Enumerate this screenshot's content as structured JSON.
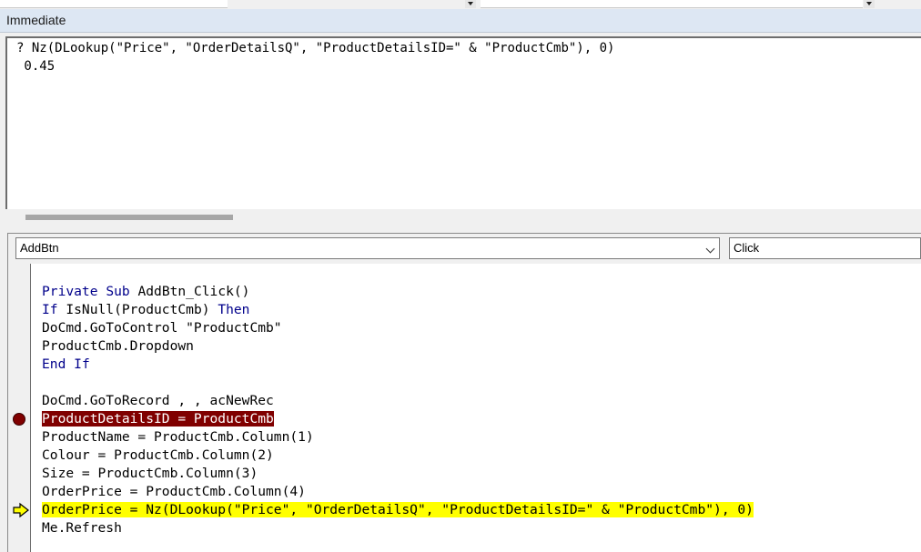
{
  "immediate": {
    "title": "Immediate",
    "lines": [
      "? Nz(DLookup(\"Price\", \"OrderDetailsQ\", \"ProductDetailsID=\" & \"ProductCmb\"), 0)",
      " 0.45"
    ]
  },
  "code_window": {
    "object_combo": "AddBtn",
    "procedure_combo": "Click",
    "code": {
      "sub_kw1": "Private",
      "sub_kw2": "Sub",
      "sub_rest": " AddBtn_Click()",
      "if_kw": "If",
      "if_mid": " IsNull(ProductCmb) ",
      "then_kw": "Then",
      "goto_control": "DoCmd.GoToControl \"ProductCmb\"",
      "dropdown": "ProductCmb.Dropdown",
      "end_kw": "End",
      "if_kw2": "If",
      "goto_record": "DoCmd.GoToRecord , , acNewRec",
      "breakpoint_line": "ProductDetailsID = ProductCmb",
      "product_name": "ProductName = ProductCmb.Column(1)",
      "colour": "Colour = ProductCmb.Column(2)",
      "size": "Size = ProductCmb.Column(3)",
      "order_price": "OrderPrice = ProductCmb.Column(4)",
      "exec_line": "OrderPrice = Nz(DLookup(\"Price\", \"OrderDetailsQ\", \"ProductDetailsID=\" & \"ProductCmb\"), 0)",
      "refresh": "Me.Refresh"
    }
  },
  "colors": {
    "keyword": "#00008b",
    "breakpoint": "#800000",
    "execution": "#ffff00"
  },
  "icons": {
    "breakpoint": "breakpoint-icon",
    "execution": "execution-pointer-icon"
  }
}
